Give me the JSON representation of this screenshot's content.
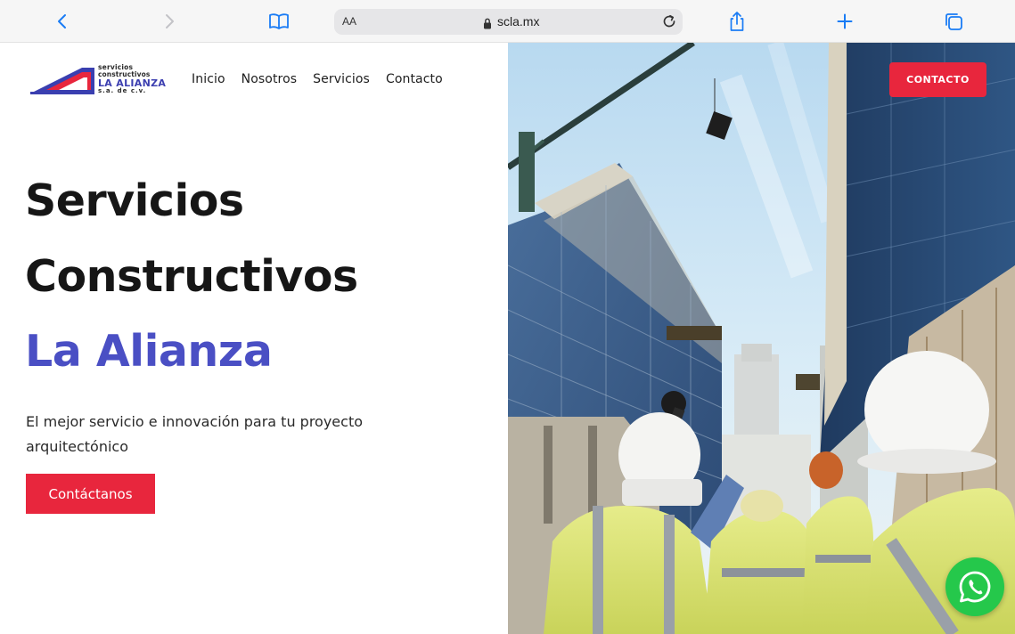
{
  "browser": {
    "text_size_label": "AA",
    "url": "scla.mx",
    "icons": [
      "back-icon",
      "forward-icon",
      "bookmarks-icon",
      "lock-icon",
      "reload-icon",
      "share-icon",
      "new-tab-icon",
      "tabs-icon"
    ]
  },
  "logo": {
    "line1": "servicios",
    "line2": "constructivos",
    "line3": "LA ALIANZA",
    "line4": "s.a. de c.v."
  },
  "nav": {
    "items": [
      "Inicio",
      "Nosotros",
      "Servicios",
      "Contacto"
    ],
    "contact_button": "CONTACTO"
  },
  "hero": {
    "title_line1": "Servicios",
    "title_line2": "Constructivos",
    "title_line3": "La Alianza",
    "subtitle": "El mejor servicio e innovación para tu proyecto arquitectónico",
    "cta_label": "Contáctanos"
  },
  "colors": {
    "accent_red": "#e8263d",
    "brand_blue": "#4a4fc4",
    "whatsapp_green": "#25c84b"
  }
}
